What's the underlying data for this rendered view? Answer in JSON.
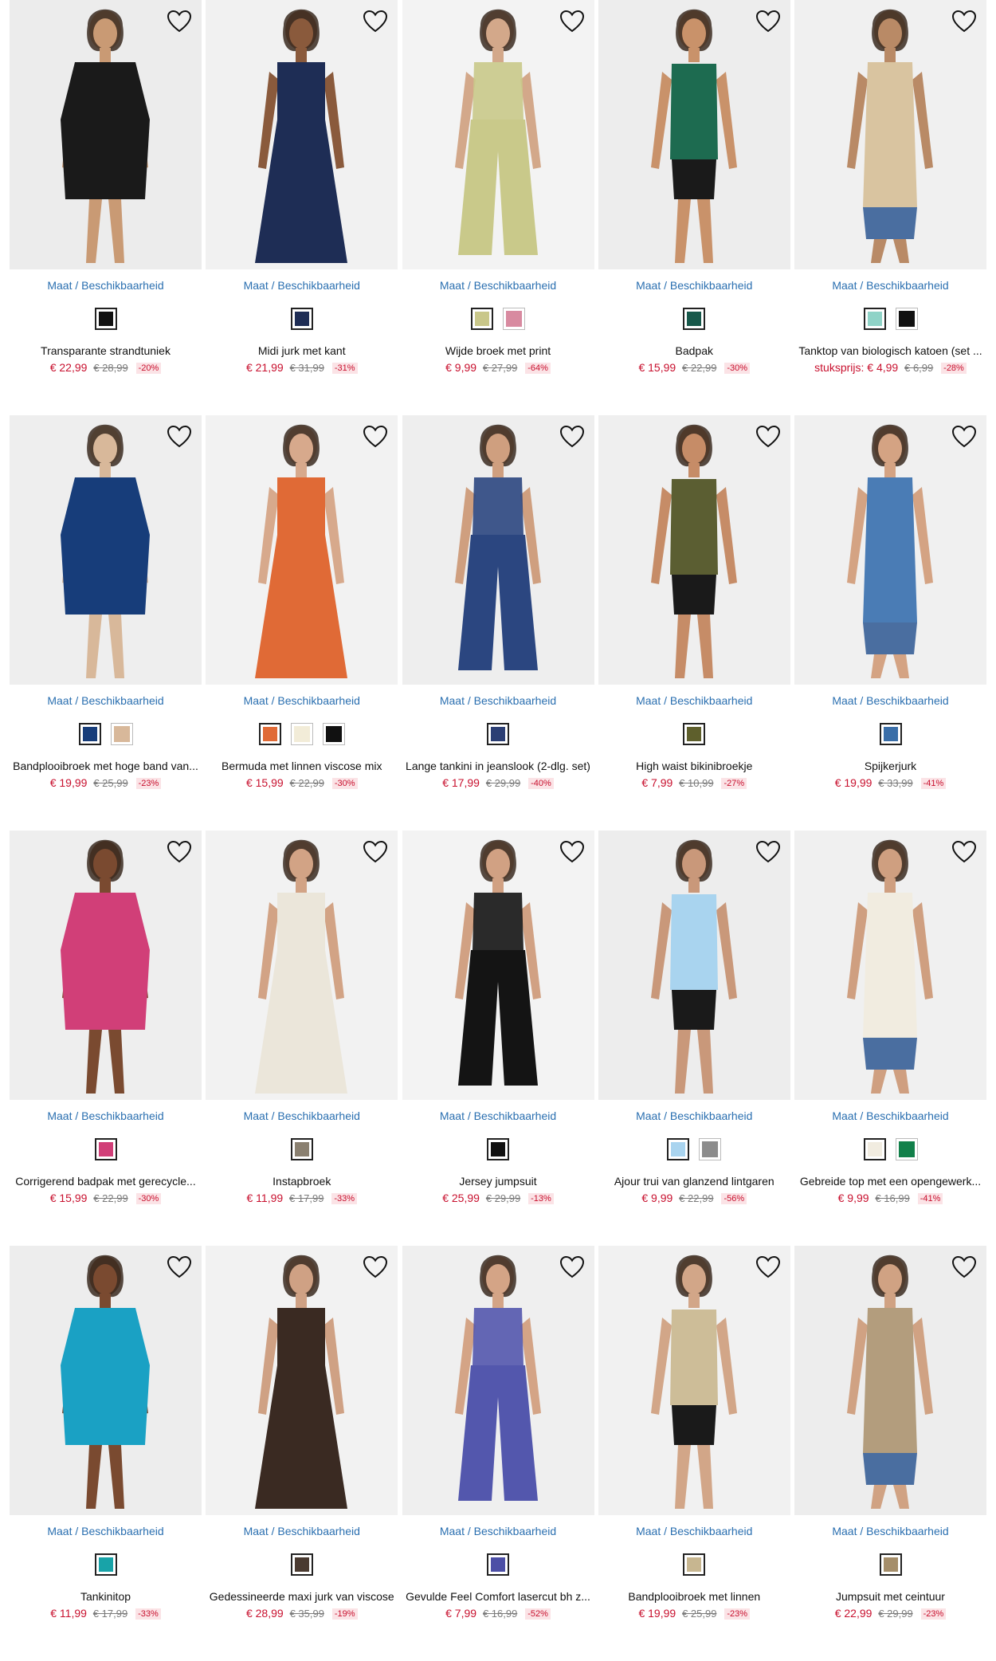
{
  "size_link_label": "Maat / Beschikbaarheid",
  "colors": {
    "price": "#c8102e",
    "link": "#2a6fb0",
    "discount_bg": "#fbe3e6"
  },
  "products": [
    {
      "name": "Transparante strandtuniek",
      "price": "€ 22,99",
      "old_price": "€ 28,99",
      "discount": "-20%",
      "swatches": [
        "#111111"
      ],
      "bg": "#ececec",
      "garment": "#1a1a1a",
      "skin": "#c99a74"
    },
    {
      "name": "Midi jurk met kant",
      "price": "€ 21,99",
      "old_price": "€ 31,99",
      "discount": "-31%",
      "swatches": [
        "#1e2d55"
      ],
      "bg": "#f1f1f1",
      "garment": "#1e2d55",
      "skin": "#8a5a3c"
    },
    {
      "name": "Wijde broek met print",
      "price": "€ 9,99",
      "old_price": "€ 27,99",
      "discount": "-64%",
      "swatches": [
        "#c9c78a",
        "#d88aa0"
      ],
      "bg": "#f3f3f3",
      "garment": "#c9c98a",
      "skin": "#d3a88a"
    },
    {
      "name": "Badpak",
      "price": "€ 15,99",
      "old_price": "€ 22,99",
      "discount": "-30%",
      "swatches": [
        "#17584a"
      ],
      "bg": "#ededed",
      "garment": "#1d6b50",
      "skin": "#c9926a"
    },
    {
      "name": "Tanktop van biologisch katoen (set ...",
      "price": "",
      "old_price": "€ 6,99",
      "discount": "-28%",
      "unit_price": "stuksprijs: € 4,99",
      "swatches": [
        "#8fd3c7",
        "#111111"
      ],
      "bg": "#f0f0f0",
      "garment": "#d9c4a0",
      "skin": "#b98a66"
    },
    {
      "name": "Bandplooibroek met hoge band van...",
      "price": "€ 19,99",
      "old_price": "€ 25,99",
      "discount": "-23%",
      "swatches": [
        "#173d7a",
        "#d8b89a"
      ],
      "bg": "#eeeeee",
      "garment": "#173d7a",
      "skin": "#d8b89a"
    },
    {
      "name": "Bermuda met linnen viscose mix",
      "price": "€ 15,99",
      "old_price": "€ 22,99",
      "discount": "-30%",
      "swatches": [
        "#e06a36",
        "#f2ecd8",
        "#111111"
      ],
      "bg": "#f2f2f2",
      "garment": "#e06a36",
      "skin": "#d7a98c"
    },
    {
      "name": "Lange tankini in jeanslook (2-dlg. set)",
      "price": "€ 17,99",
      "old_price": "€ 29,99",
      "discount": "-40%",
      "swatches": [
        "#2b3e74"
      ],
      "bg": "#eeeeee",
      "garment": "#2b4680",
      "skin": "#cf9f7f"
    },
    {
      "name": "High waist bikinibroekje",
      "price": "€ 7,99",
      "old_price": "€ 10,99",
      "discount": "-27%",
      "swatches": [
        "#5e5f2c"
      ],
      "bg": "#efefef",
      "garment": "#5b5e32",
      "skin": "#c68c67"
    },
    {
      "name": "Spijkerjurk",
      "price": "€ 19,99",
      "old_price": "€ 33,99",
      "discount": "-41%",
      "swatches": [
        "#3a6ea8"
      ],
      "bg": "#f0f0f0",
      "garment": "#4a7cb5",
      "skin": "#d4a383"
    },
    {
      "name": "Corrigerend badpak met gerecycle...",
      "price": "€ 15,99",
      "old_price": "€ 22,99",
      "discount": "-30%",
      "swatches": [
        "#d13f78"
      ],
      "bg": "#eeeeee",
      "garment": "#d13f78",
      "skin": "#7a4a30"
    },
    {
      "name": "Instapbroek",
      "price": "€ 11,99",
      "old_price": "€ 17,99",
      "discount": "-33%",
      "swatches": [
        "#8a8070"
      ],
      "bg": "#f2f2f2",
      "garment": "#ebe6da",
      "skin": "#d2a385"
    },
    {
      "name": "Jersey jumpsuit",
      "price": "€ 25,99",
      "old_price": "€ 29,99",
      "discount": "-13%",
      "swatches": [
        "#111111"
      ],
      "bg": "#f3f3f3",
      "garment": "#141414",
      "skin": "#d1a183"
    },
    {
      "name": "Ajour trui van glanzend lintgaren",
      "price": "€ 9,99",
      "old_price": "€ 22,99",
      "discount": "-56%",
      "swatches": [
        "#a9d4ef",
        "#8c8c8c"
      ],
      "bg": "#ededed",
      "garment": "#a9d4ef",
      "skin": "#c9987a"
    },
    {
      "name": "Gebreide top met een opengewerk...",
      "price": "€ 9,99",
      "old_price": "€ 16,99",
      "discount": "-41%",
      "swatches": [
        "#f1ece0",
        "#12804a"
      ],
      "bg": "#f0f0f0",
      "garment": "#f1ece0",
      "skin": "#cf9f80"
    },
    {
      "name": "Tankinitop",
      "price": "€ 11,99",
      "old_price": "€ 17,99",
      "discount": "-33%",
      "swatches": [
        "#18a3a8"
      ],
      "bg": "#ededed",
      "garment": "#1aa1c4",
      "skin": "#7a4a30"
    },
    {
      "name": "Gedessineerde maxi jurk van viscose",
      "price": "€ 28,99",
      "old_price": "€ 35,99",
      "discount": "-19%",
      "swatches": [
        "#4a3a30"
      ],
      "bg": "#f2f2f2",
      "garment": "#3a2a22",
      "skin": "#cfa184"
    },
    {
      "name": "Gevulde Feel Comfort lasercut bh z...",
      "price": "€ 7,99",
      "old_price": "€ 16,99",
      "discount": "-52%",
      "swatches": [
        "#4c4fa6"
      ],
      "bg": "#efefef",
      "garment": "#5357ad",
      "skin": "#d4a486"
    },
    {
      "name": "Bandplooibroek met linnen",
      "price": "€ 19,99",
      "old_price": "€ 25,99",
      "discount": "-23%",
      "swatches": [
        "#c7b690"
      ],
      "bg": "#f1f1f1",
      "garment": "#cdbd98",
      "skin": "#d2a688"
    },
    {
      "name": "Jumpsuit met ceintuur",
      "price": "€ 22,99",
      "old_price": "€ 29,99",
      "discount": "-23%",
      "swatches": [
        "#a58e6a"
      ],
      "bg": "#ededed",
      "garment": "#b39d7d",
      "skin": "#d0a283"
    }
  ]
}
